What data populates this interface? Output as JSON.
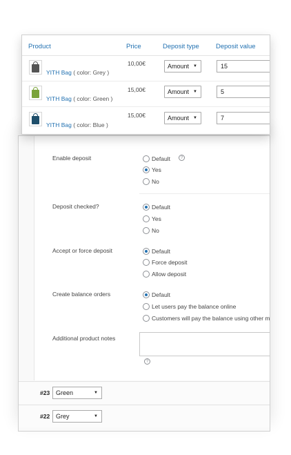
{
  "table": {
    "headers": {
      "product": "Product",
      "price": "Price",
      "deposit_type": "Deposit type",
      "deposit_value": "Deposit value"
    },
    "rows": [
      {
        "link": "YITH Bag",
        "variant": "( color: Grey )",
        "price": "10,00€",
        "deposit_type": "Amount",
        "deposit_value": "15",
        "bag_color": "#555555"
      },
      {
        "link": "YITH Bag",
        "variant": "( color: Green )",
        "price": "15,00€",
        "deposit_type": "Amount",
        "deposit_value": "5",
        "bag_color": "#7aa33a"
      },
      {
        "link": "YITH Bag",
        "variant": "( color: Blue )",
        "price": "15,00€",
        "deposit_type": "Amount",
        "deposit_value": "7",
        "bag_color": "#1f4f6b"
      }
    ]
  },
  "settings": {
    "enable_deposit": {
      "label": "Enable deposit",
      "options": [
        "Default",
        "Yes",
        "No"
      ],
      "selected": "Yes"
    },
    "deposit_checked": {
      "label": "Deposit checked?",
      "options": [
        "Default",
        "Yes",
        "No"
      ],
      "selected": "Default"
    },
    "accept_force": {
      "label": "Accept or force deposit",
      "options": [
        "Default",
        "Force deposit",
        "Allow deposit"
      ],
      "selected": "Default"
    },
    "balance_orders": {
      "label": "Create balance orders",
      "options": [
        "Default",
        "Let users pay the balance online",
        "Customers will pay the balance using other means"
      ],
      "selected": "Default"
    },
    "notes": {
      "label": "Additional product notes",
      "value": ""
    },
    "help_glyph": "?"
  },
  "variations": [
    {
      "id": "#23",
      "value": "Green"
    },
    {
      "id": "#22",
      "value": "Grey"
    }
  ],
  "caret_glyph": "▼",
  "colors": {
    "link": "#2271b1",
    "radio_on": "#2271b1"
  }
}
